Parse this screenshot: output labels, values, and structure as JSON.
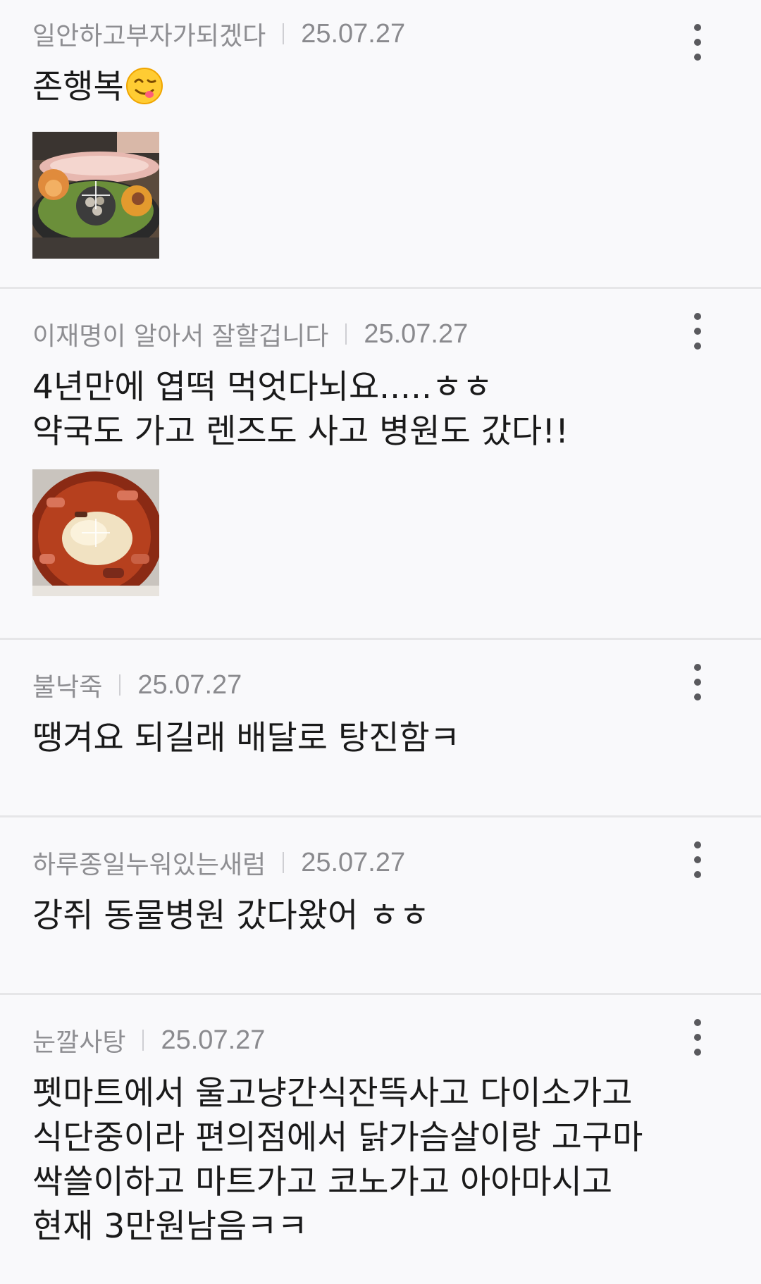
{
  "comments": [
    {
      "author": "일안하고부자가되겠다",
      "date": "25.07.27",
      "text": "존행복",
      "emoji": "face-savoring-food-emoji",
      "has_image": true,
      "image_subject": "grilled pork belly with side dishes"
    },
    {
      "author": "이재명이 알아서 잘할겁니다",
      "date": "25.07.27",
      "text": "4년만에 엽떡 먹엇다뇌요.....ㅎㅎ\n약국도 가고 렌즈도 사고 병원도 갔다!!",
      "has_image": true,
      "image_subject": "tteokbokki with melted cheese"
    },
    {
      "author": "불낙죽",
      "date": "25.07.27",
      "text": "땡겨요 되길래 배달로 탕진함ㅋ",
      "has_image": false
    },
    {
      "author": "하루종일누워있는새럼",
      "date": "25.07.27",
      "text": "강쥐 동물병원 갔다왔어 ㅎㅎ",
      "has_image": false
    },
    {
      "author": "눈깔사탕",
      "date": "25.07.27",
      "text": "펫마트에서 울고냥간식잔뜩사고 다이소가고 식단중이라 편의점에서 닭가슴살이랑 고구마 싹쓸이하고 마트가고 코노가고 아아마시고 현재 3만원남음ㅋㅋ",
      "has_image": false
    }
  ],
  "icons": {
    "more": "more-vertical-icon",
    "expand": "plus-icon"
  },
  "colors": {
    "background": "#f9f9fb",
    "divider": "#e6e6e8",
    "meta_text": "#8a8a8e",
    "body_text": "#1a1a1a"
  }
}
